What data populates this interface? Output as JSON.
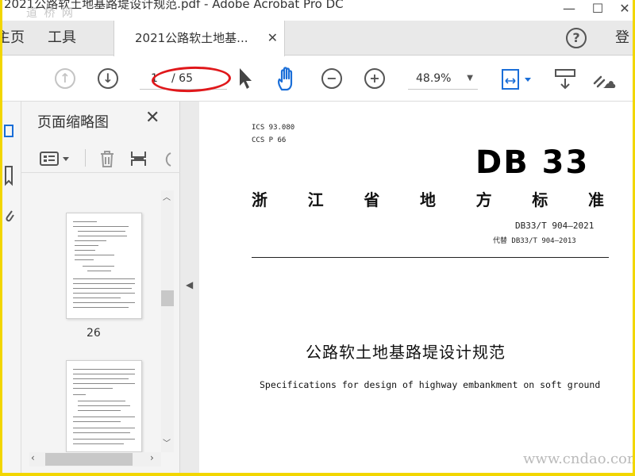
{
  "window": {
    "title": "2021公路软土地基路堤设计规范.pdf - Adobe Acrobat Pro DC",
    "watermark_top": "道 桥 网"
  },
  "tabs": {
    "home": "主页",
    "tools": "工具",
    "document": "2021公路软土地基...",
    "login": "登"
  },
  "toolbar": {
    "page_current": "1",
    "page_total": "/ 65",
    "zoom": "48.9%"
  },
  "thumbnails": {
    "title": "页面缩略图",
    "page_label": "26"
  },
  "document": {
    "ics": "ICS 93.080",
    "ccs": "CCS P 66",
    "db_logo": "DB 33",
    "provincial_standard": [
      "浙",
      "江",
      "省",
      "地",
      "方",
      "标",
      "准"
    ],
    "standard_number": "DB33/T 904—2021",
    "replaces": "代替 DB33/T 904—2013",
    "title_cn": "公路软土地基路堤设计规范",
    "title_en": "Specifications for design of highway embankment on soft ground"
  },
  "watermark_bottom": "www.cndao.com",
  "colors": {
    "border": "#f2d600",
    "annotation_ellipse": "#e0181b",
    "active_icon": "#1a6ed8"
  }
}
